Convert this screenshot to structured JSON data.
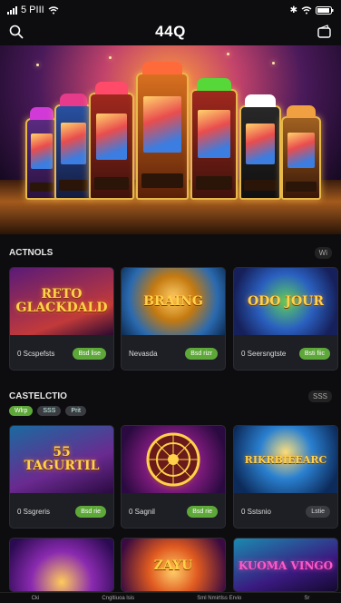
{
  "status": {
    "carrier": "5 PIII",
    "signal_icon": "cellular-signal-icon",
    "wifi_icon": "wifi-icon",
    "bt_icon": "bluetooth-icon",
    "battery_icon": "battery-icon"
  },
  "header": {
    "logo": "44Q",
    "search_icon": "search-icon",
    "wallet_icon": "wallet-icon"
  },
  "hero": {
    "image": "illuminated slot machines casino banner"
  },
  "section1": {
    "title": "ACTNOLS",
    "more": "Wi",
    "games": [
      {
        "art": "RETO GLACKDALD",
        "name": "0 Scspefsts",
        "button": "Bsd lise"
      },
      {
        "art": "BRAING",
        "name": "Nevasda",
        "button": "Bsd rizr"
      },
      {
        "art": "ODO JOUR",
        "name": "0 Seersngtste",
        "button": "Bsti fiic"
      }
    ]
  },
  "section2": {
    "title": "CASTELCTIO",
    "more": "SSS",
    "chips": [
      "Wlrp",
      "SSS",
      "Prit"
    ],
    "games": [
      {
        "art": "55 TAGURTIL",
        "name": "0 Ssgreris",
        "button": "Bsd rie"
      },
      {
        "art": "",
        "name": "0 Sagnil",
        "button": "Bsd rie"
      },
      {
        "art": "RIKRBIEEARC",
        "name": "0 Sstsnio",
        "button": "Lstie"
      }
    ]
  },
  "section3": {
    "games": [
      {
        "art": ""
      },
      {
        "art": "ZAYU"
      },
      {
        "art": "KUOMA VINGO"
      }
    ]
  },
  "bottom_nav": [
    "Cki",
    "Cngltiuoa lsis",
    "Sml Nmirtlss Ervio",
    "Sr"
  ]
}
